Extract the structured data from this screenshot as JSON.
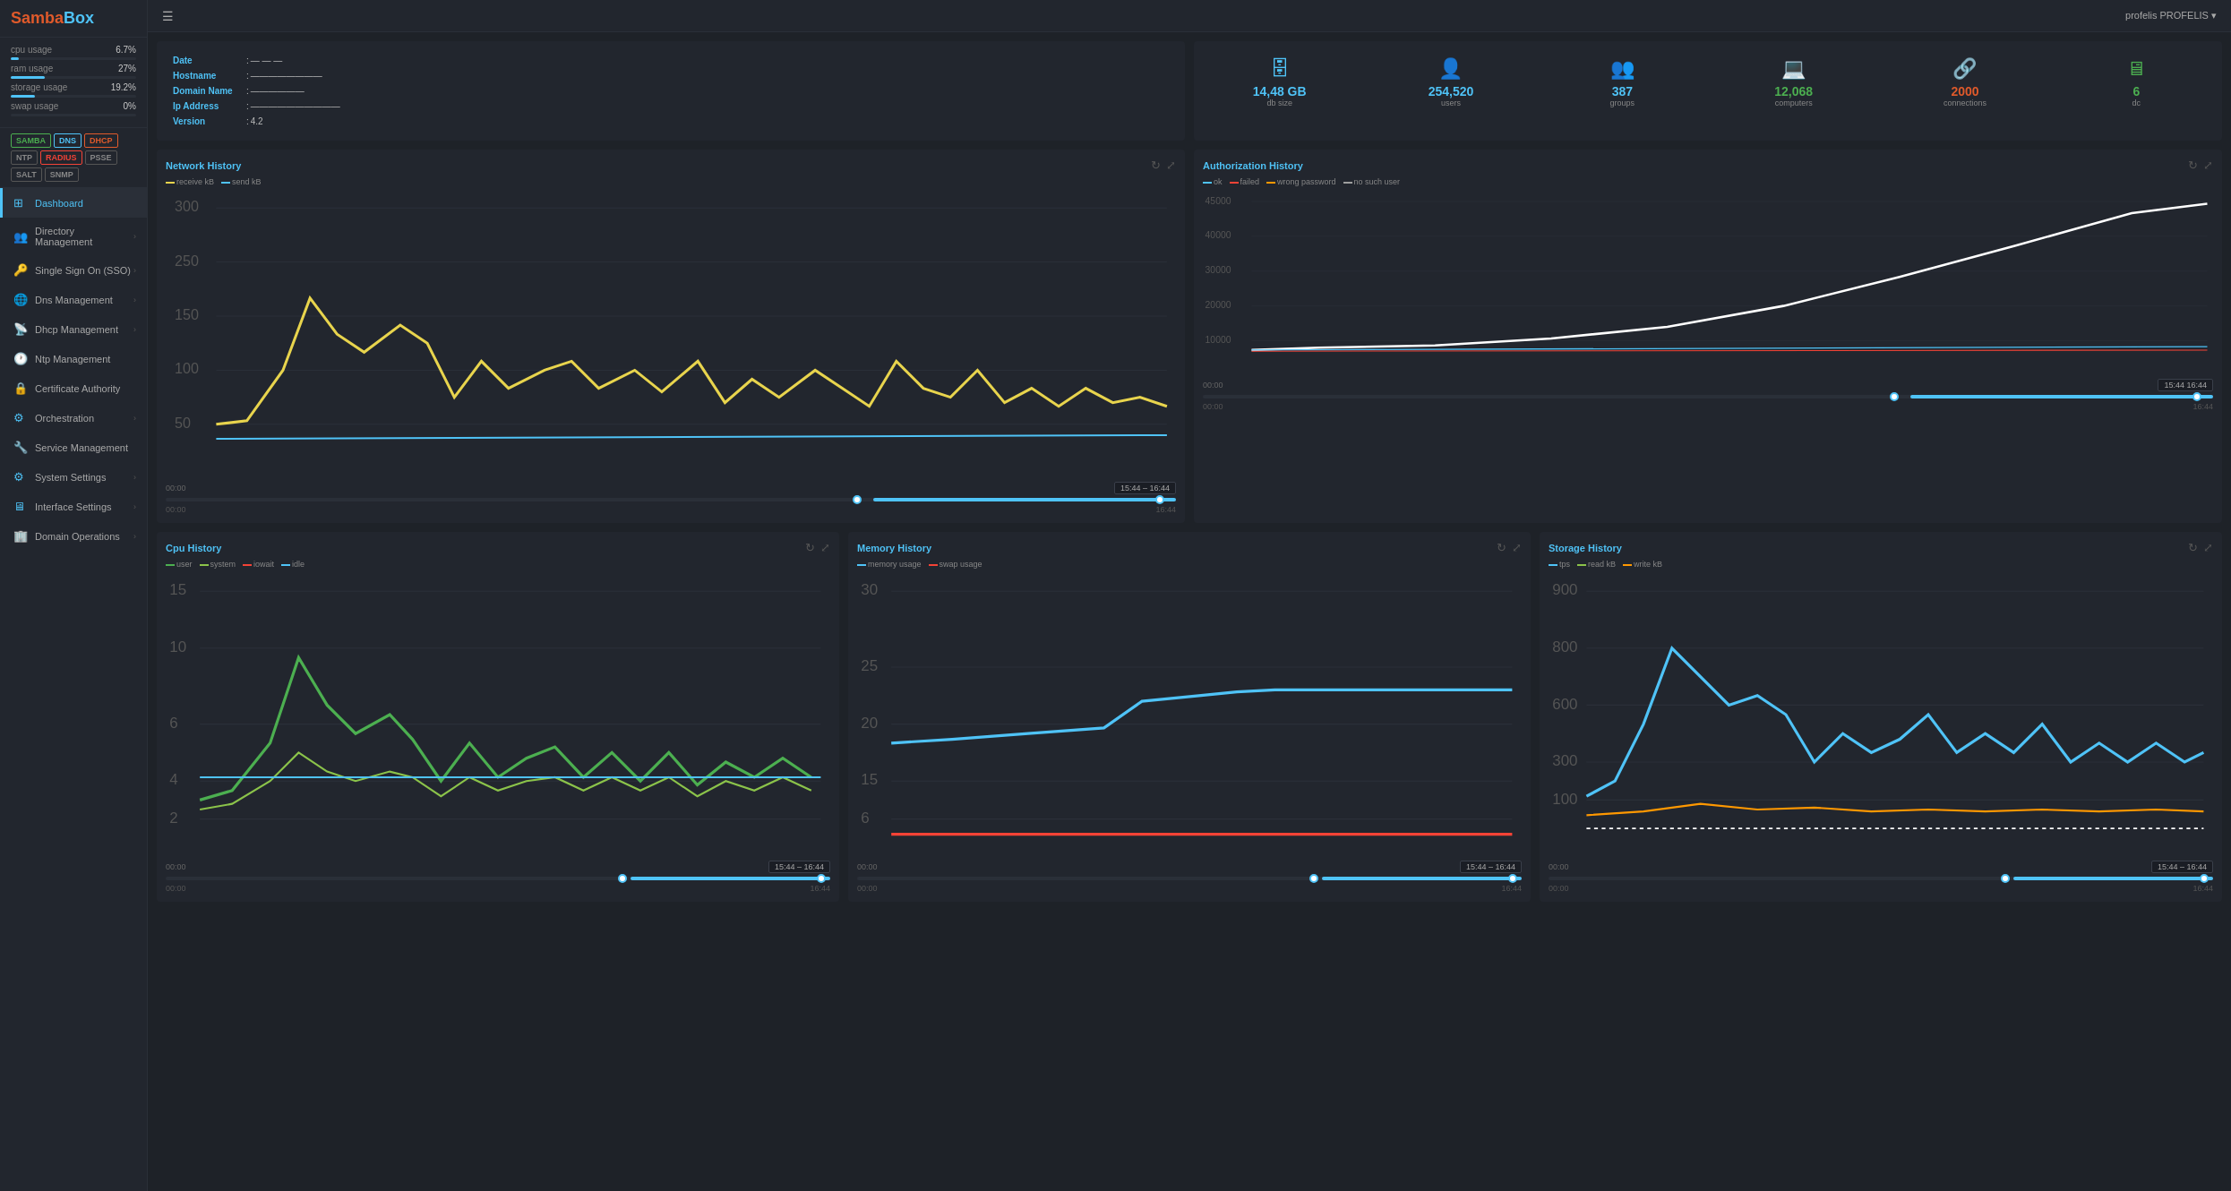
{
  "logo": {
    "samba": "Samba",
    "box": "Box"
  },
  "stats": {
    "cpu": {
      "label": "cpu usage",
      "value": "6.7%",
      "pct": 6.7
    },
    "ram": {
      "label": "ram usage",
      "value": "27%",
      "pct": 27
    },
    "storage": {
      "label": "storage usage",
      "value": "19.2%",
      "pct": 19.2
    },
    "swap": {
      "label": "swap usage",
      "value": "0%",
      "pct": 0
    }
  },
  "badges": [
    {
      "label": "SAMBA",
      "color": "green"
    },
    {
      "label": "DNS",
      "color": "blue"
    },
    {
      "label": "DHCP",
      "color": "orange"
    },
    {
      "label": "NTP",
      "color": "gray"
    },
    {
      "label": "RADIUS",
      "color": "red"
    },
    {
      "label": "PSSE",
      "color": "gray"
    },
    {
      "label": "SALT",
      "color": "gray"
    },
    {
      "label": "SNMP",
      "color": "gray"
    }
  ],
  "nav": [
    {
      "id": "dashboard",
      "label": "Dashboard",
      "icon": "⊞",
      "active": true,
      "arrow": false
    },
    {
      "id": "directory",
      "label": "Directory Management",
      "icon": "👥",
      "active": false,
      "arrow": true
    },
    {
      "id": "sso",
      "label": "Single Sign On (SSO)",
      "icon": "🔑",
      "active": false,
      "arrow": true
    },
    {
      "id": "dns",
      "label": "Dns Management",
      "icon": "🌐",
      "active": false,
      "arrow": true
    },
    {
      "id": "dhcp",
      "label": "Dhcp Management",
      "icon": "📡",
      "active": false,
      "arrow": true
    },
    {
      "id": "ntp",
      "label": "Ntp Management",
      "icon": "🕐",
      "active": false,
      "arrow": false
    },
    {
      "id": "ca",
      "label": "Certificate Authority",
      "icon": "🔒",
      "active": false,
      "arrow": false
    },
    {
      "id": "orch",
      "label": "Orchestration",
      "icon": "⚙",
      "active": false,
      "arrow": true
    },
    {
      "id": "svcmgmt",
      "label": "Service Management",
      "icon": "🔧",
      "active": false,
      "arrow": false
    },
    {
      "id": "sysset",
      "label": "System Settings",
      "icon": "⚙",
      "active": false,
      "arrow": true
    },
    {
      "id": "ifset",
      "label": "Interface Settings",
      "icon": "🖥",
      "active": false,
      "arrow": true
    },
    {
      "id": "domops",
      "label": "Domain Operations",
      "icon": "🏢",
      "active": false,
      "arrow": true
    }
  ],
  "topbar": {
    "user": "profelis PROFELIS ▾"
  },
  "infocard": {
    "rows": [
      {
        "key": "Date",
        "value": "— — —"
      },
      {
        "key": "Hostname",
        "value": "————————"
      },
      {
        "key": "Domain Name",
        "value": "——————"
      },
      {
        "key": "Ip Address",
        "value": "——————————"
      },
      {
        "key": "Version",
        "value": "4.2"
      }
    ]
  },
  "metrics": [
    {
      "icon": "🗄",
      "value": "14,48 GB",
      "label": "db size",
      "color": "blue"
    },
    {
      "icon": "👤",
      "value": "254,520",
      "label": "users",
      "color": "blue"
    },
    {
      "icon": "👥",
      "value": "387",
      "label": "groups",
      "color": "blue"
    },
    {
      "icon": "💻",
      "value": "12,068",
      "label": "computers",
      "color": "green"
    },
    {
      "icon": "🔗",
      "value": "2000",
      "label": "connections",
      "color": "orange"
    },
    {
      "icon": "🖥",
      "value": "6",
      "label": "dc",
      "color": "green"
    }
  ],
  "charts": {
    "network": {
      "title": "Network History",
      "legend": [
        {
          "label": "receive kB",
          "color": "#e8d44d"
        },
        {
          "label": "send kB",
          "color": "#4fc3f7"
        }
      ],
      "time_range": "15:44 – 16:44",
      "time_start": "00:00",
      "time_end": "16:44"
    },
    "auth": {
      "title": "Authorization History",
      "legend": [
        {
          "label": "ok",
          "color": "#4fc3f7"
        },
        {
          "label": "failed",
          "color": "#f44336"
        },
        {
          "label": "wrong password",
          "color": "#ff9800"
        },
        {
          "label": "no such user",
          "color": "#9e9e9e"
        }
      ],
      "time_range": "15:44  16:44",
      "time_start": "00:00",
      "time_end": "16:44"
    },
    "cpu": {
      "title": "Cpu History",
      "legend": [
        {
          "label": "user",
          "color": "#4caf50"
        },
        {
          "label": "system",
          "color": "#8bc34a"
        },
        {
          "label": "iowait",
          "color": "#f44336"
        },
        {
          "label": "idle",
          "color": "#4fc3f7"
        }
      ],
      "time_range": "15:44 – 16:44",
      "time_start": "00:00",
      "time_end": "16:44"
    },
    "memory": {
      "title": "Memory History",
      "legend": [
        {
          "label": "memory usage",
          "color": "#4fc3f7"
        },
        {
          "label": "swap usage",
          "color": "#f44336"
        }
      ],
      "time_range": "15:44 – 16:44",
      "time_start": "00:00",
      "time_end": "16:44"
    },
    "storage": {
      "title": "Storage History",
      "legend": [
        {
          "label": "tps",
          "color": "#4fc3f7"
        },
        {
          "label": "read kB",
          "color": "#8bc34a"
        },
        {
          "label": "write kB",
          "color": "#ff9800"
        }
      ],
      "time_range": "15:44 – 16:44",
      "time_start": "00:00",
      "time_end": "16:44"
    }
  }
}
